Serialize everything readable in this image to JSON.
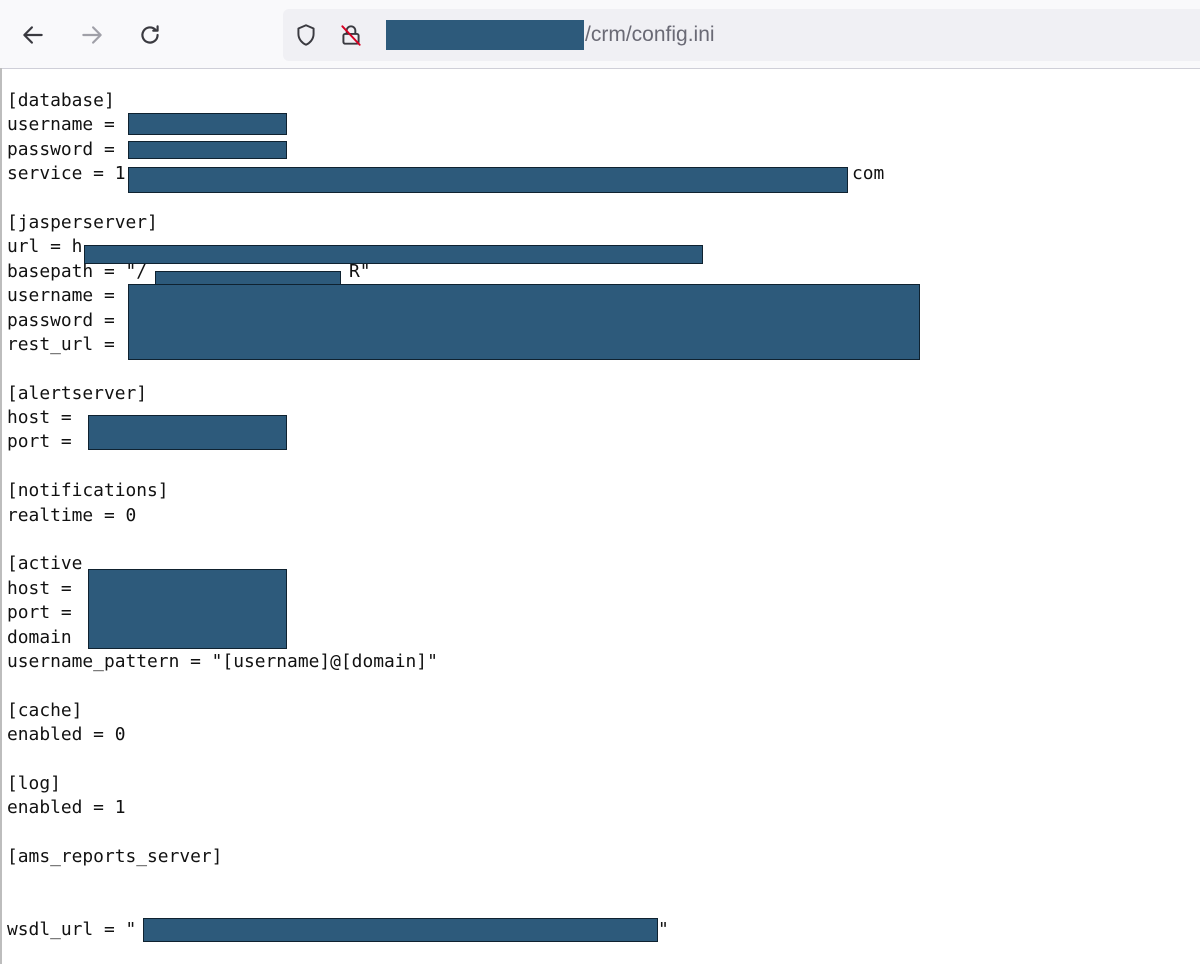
{
  "browser": {
    "url_visible": "/crm/config.ini",
    "icons": [
      "back-arrow-icon",
      "forward-arrow-icon",
      "reload-icon",
      "shield-icon",
      "insecure-lock-icon"
    ]
  },
  "config_lines": [
    {
      "kind": "section",
      "text": "[database]"
    },
    {
      "kind": "line",
      "text": "username ="
    },
    {
      "kind": "line",
      "text": "password ="
    },
    {
      "kind": "line",
      "text": "service = 1",
      "suffix": "com"
    },
    {
      "kind": "blank"
    },
    {
      "kind": "section",
      "text": "[jasperserver]"
    },
    {
      "kind": "line",
      "text": "url = h"
    },
    {
      "kind": "line",
      "text": "basepath = \"/",
      "suffix": "R\""
    },
    {
      "kind": "line",
      "text": "username ="
    },
    {
      "kind": "line",
      "text": "password ="
    },
    {
      "kind": "line",
      "text": "rest_url ="
    },
    {
      "kind": "blank"
    },
    {
      "kind": "section",
      "text": "[alertserver]"
    },
    {
      "kind": "line",
      "text": "host ="
    },
    {
      "kind": "line",
      "text": "port ="
    },
    {
      "kind": "blank"
    },
    {
      "kind": "section",
      "text": "[notifications]"
    },
    {
      "kind": "line",
      "text": "realtime = 0"
    },
    {
      "kind": "blank"
    },
    {
      "kind": "section",
      "text": "[active"
    },
    {
      "kind": "line",
      "text": "host ="
    },
    {
      "kind": "line",
      "text": "port ="
    },
    {
      "kind": "line",
      "text": "domain"
    },
    {
      "kind": "line",
      "text": "username_pattern = \"[username]@[domain]\""
    },
    {
      "kind": "blank"
    },
    {
      "kind": "section",
      "text": "[cache]"
    },
    {
      "kind": "line",
      "text": "enabled = 0"
    },
    {
      "kind": "blank"
    },
    {
      "kind": "section",
      "text": "[log]"
    },
    {
      "kind": "line",
      "text": "enabled = 1"
    },
    {
      "kind": "blank"
    },
    {
      "kind": "section",
      "text": "[ams_reports_server]"
    },
    {
      "kind": "blank"
    },
    {
      "kind": "blank"
    },
    {
      "kind": "line",
      "text": "wsdl_url = \"",
      "suffix": "\""
    }
  ],
  "colors": {
    "redaction": "#2d5a7b",
    "text": "#111111",
    "url_text": "#6a6a75"
  }
}
